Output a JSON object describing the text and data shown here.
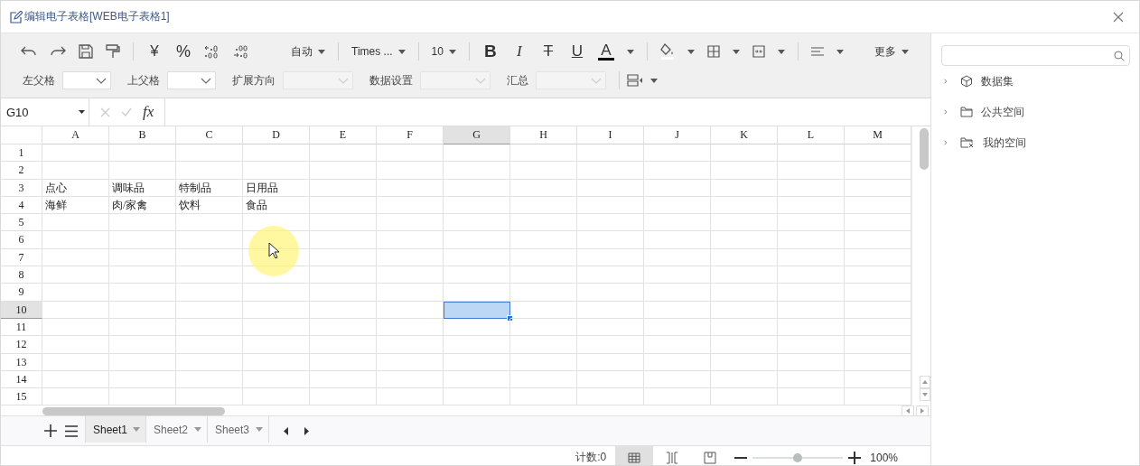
{
  "window": {
    "title": "编辑电子表格[WEB电子表格1]"
  },
  "toolbar": {
    "currency": "¥",
    "percent": "%",
    "number_format": "自动",
    "font": "Times ...",
    "font_size": "10",
    "bold": "B",
    "italic": "I",
    "strikethrough": "T",
    "underline": "U",
    "font_color": "A",
    "more": "更多"
  },
  "parameters": [
    {
      "label": "左父格",
      "disabled": false
    },
    {
      "label": "上父格",
      "disabled": false
    },
    {
      "label": "扩展方向",
      "disabled": true
    },
    {
      "label": "数据设置",
      "disabled": true
    },
    {
      "label": "汇总",
      "disabled": true
    }
  ],
  "formula_bar": {
    "name_box": "G10",
    "fx": "fx"
  },
  "grid": {
    "columns": [
      {
        "label": "A",
        "selected": false
      },
      {
        "label": "B",
        "selected": false
      },
      {
        "label": "C",
        "selected": false
      },
      {
        "label": "D",
        "selected": false
      },
      {
        "label": "E",
        "selected": false
      },
      {
        "label": "F",
        "selected": false
      },
      {
        "label": "G",
        "selected": true
      },
      {
        "label": "H",
        "selected": false
      },
      {
        "label": "I",
        "selected": false
      },
      {
        "label": "J",
        "selected": false
      },
      {
        "label": "K",
        "selected": false
      },
      {
        "label": "L",
        "selected": false
      },
      {
        "label": "M",
        "selected": false
      }
    ],
    "rows": [
      {
        "label": "1",
        "selected": false
      },
      {
        "label": "2",
        "selected": false
      },
      {
        "label": "3",
        "selected": false,
        "cells": [
          "点心",
          "调味品",
          "特制品",
          "日用品"
        ]
      },
      {
        "label": "4",
        "selected": false,
        "cells": [
          "海鲜",
          "肉/家禽",
          "饮料",
          "食品"
        ]
      },
      {
        "label": "5",
        "selected": false
      },
      {
        "label": "6",
        "selected": false
      },
      {
        "label": "7",
        "selected": false
      },
      {
        "label": "8",
        "selected": false
      },
      {
        "label": "9",
        "selected": false
      },
      {
        "label": "10",
        "selected": true
      },
      {
        "label": "11",
        "selected": false
      },
      {
        "label": "12",
        "selected": false
      },
      {
        "label": "13",
        "selected": false
      },
      {
        "label": "14",
        "selected": false
      },
      {
        "label": "15",
        "selected": false
      }
    ]
  },
  "sheet_tabs": [
    {
      "label": "Sheet1",
      "selected": true
    },
    {
      "label": "Sheet2",
      "selected": false
    },
    {
      "label": "Sheet3",
      "selected": false
    }
  ],
  "status_bar": {
    "count": "计数:0",
    "views": [
      {
        "selected": true
      },
      {
        "selected": false
      },
      {
        "selected": false
      }
    ],
    "zoom": {
      "level": 0.5,
      "reading": "100%"
    }
  },
  "side_panel": {
    "tree": [
      {
        "label": "数据集",
        "expanded": false
      },
      {
        "label": "公共空间",
        "expanded": false
      },
      {
        "label": "我的空间",
        "expanded": false
      }
    ]
  }
}
